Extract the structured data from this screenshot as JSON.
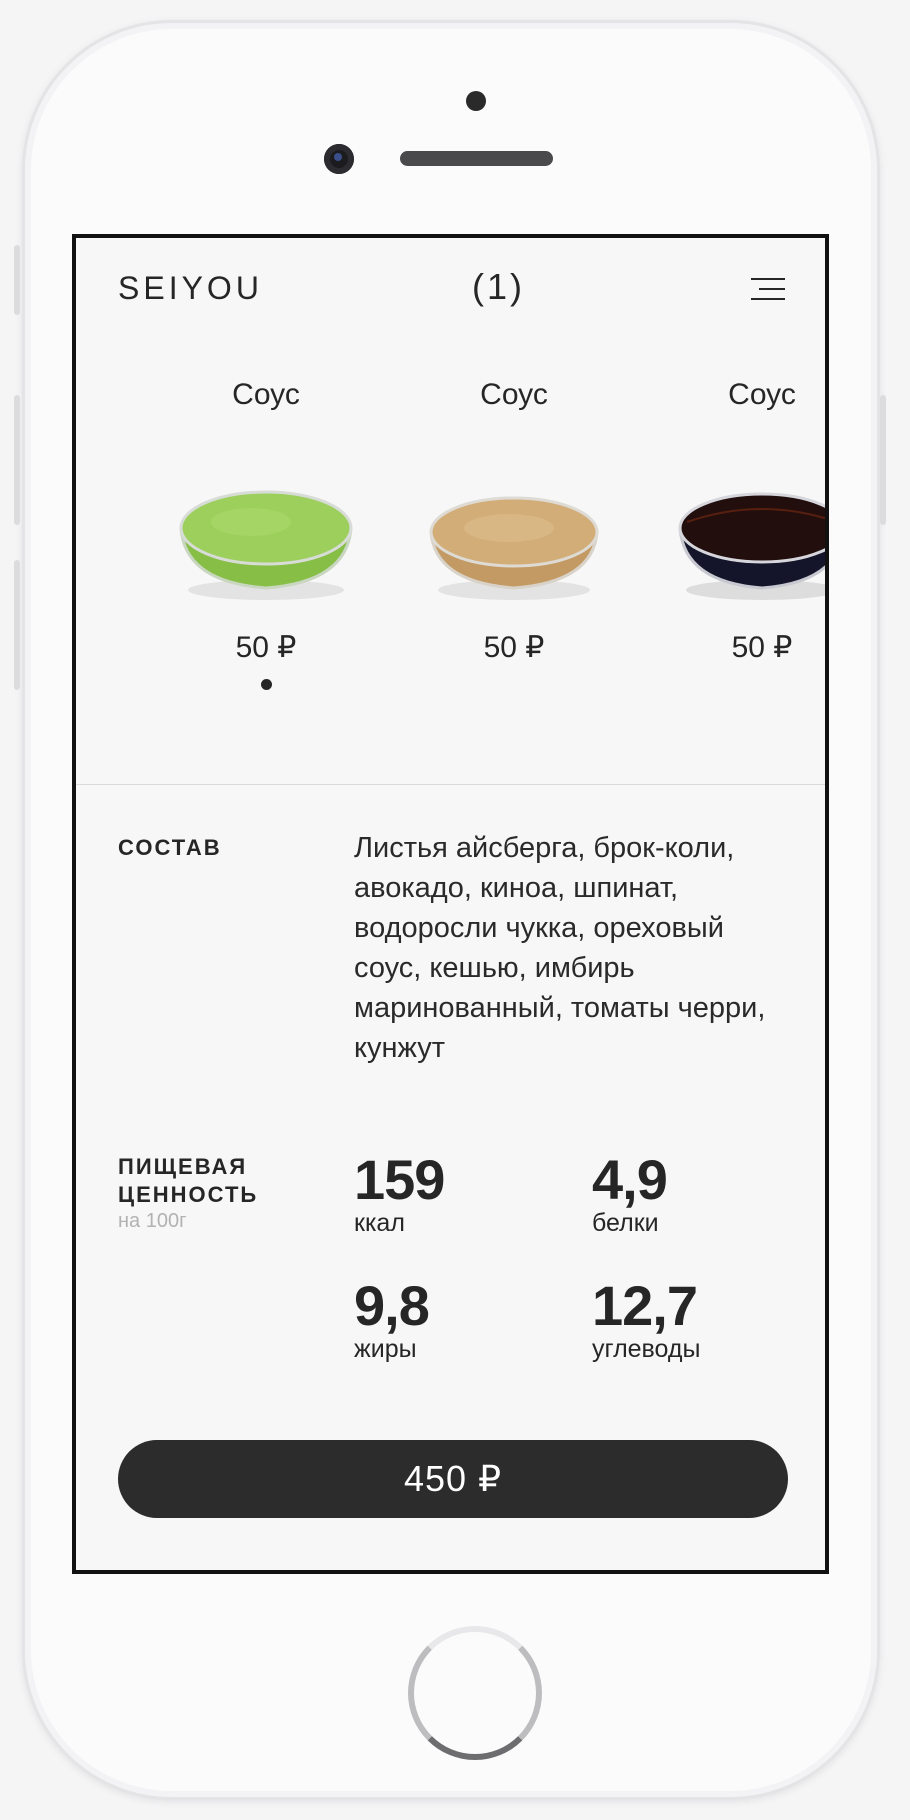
{
  "header": {
    "logo": "SEIYOU",
    "cart_count": "(1)",
    "menu_icon": "menu-icon"
  },
  "sauces": [
    {
      "name": "Соус",
      "price": "50 ₽",
      "color": "#8dc64a",
      "selected": true
    },
    {
      "name": "Соус",
      "price": "50 ₽",
      "color": "#c9a06a",
      "selected": false
    },
    {
      "name": "Соус",
      "price": "50 ₽",
      "color": "#1a0d0d",
      "selected": false
    }
  ],
  "composition": {
    "label": "СОСТАВ",
    "text": "Листья айсберга, брок-коли, авокадо, киноа, шпинат, водоросли чукка, ореховый соус, кешью, имбирь маринованный, томаты черри, кунжут"
  },
  "nutrition": {
    "label_line1": "ПИЩЕВАЯ",
    "label_line2": "ЦЕННОСТЬ",
    "per": "на 100г",
    "items": [
      {
        "value": "159",
        "label": "ккал"
      },
      {
        "value": "4,9",
        "label": "белки"
      },
      {
        "value": "9,8",
        "label": "жиры"
      },
      {
        "value": "12,7",
        "label": "углеводы"
      }
    ]
  },
  "order_button": {
    "label": "450 ₽"
  },
  "colors": {
    "accent": "#2c2c2c",
    "background": "#f7f7f7"
  }
}
